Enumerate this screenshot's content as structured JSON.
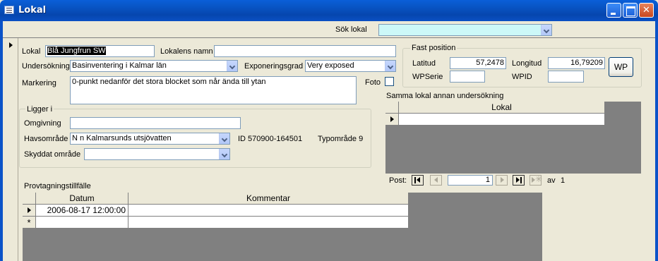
{
  "window": {
    "title": "Lokal"
  },
  "search": {
    "label": "Sök lokal",
    "value": ""
  },
  "form": {
    "lokal_label": "Lokal",
    "lokal_value": "Blå Jungfrun SW",
    "namn_label": "Lokalens namn",
    "namn_value": "",
    "undersokning_label": "Undersökning",
    "undersokning_value": "Basinventering i Kalmar län",
    "exponering_label": "Exponeringsgrad",
    "exponering_value": "Very exposed",
    "markering_label": "Markering",
    "markering_value": "0-punkt nedanför det stora blocket som når ända till ytan",
    "foto_label": "Foto"
  },
  "fast_position": {
    "title": "Fast position",
    "latitud_label": "Latitud",
    "latitud_value": "57,2478",
    "longitud_label": "Longitud",
    "longitud_value": "16,79209",
    "wpserie_label": "WPSerie",
    "wpserie_value": "",
    "wpid_label": "WPID",
    "wpid_value": "",
    "wp_button": "WP"
  },
  "ligger_i": {
    "title": "Ligger i",
    "omgivning_label": "Omgivning",
    "omgivning_value": "",
    "havsomrade_label": "Havsområde",
    "havsomrade_value": "N n Kalmarsunds utsjövatten",
    "id_text": "ID 570900-164501",
    "typomrade_text": "Typområde 9",
    "skyddat_label": "Skyddat område",
    "skyddat_value": ""
  },
  "samma_lokal": {
    "title": "Samma lokal annan undersökning",
    "column": "Lokal",
    "nav": {
      "post_label": "Post:",
      "current": "1",
      "of_label": "av",
      "total": "1"
    }
  },
  "provtagning": {
    "title": "Provtagningstillfälle",
    "columns": [
      "Datum",
      "Kommentar"
    ],
    "rows": [
      {
        "datum": "2006-08-17 12:00:00",
        "kommentar": ""
      }
    ],
    "new_row_marker": "*"
  },
  "icons": {
    "window_icon": "form-icon",
    "record_selector": "current-record-arrow-icon"
  }
}
